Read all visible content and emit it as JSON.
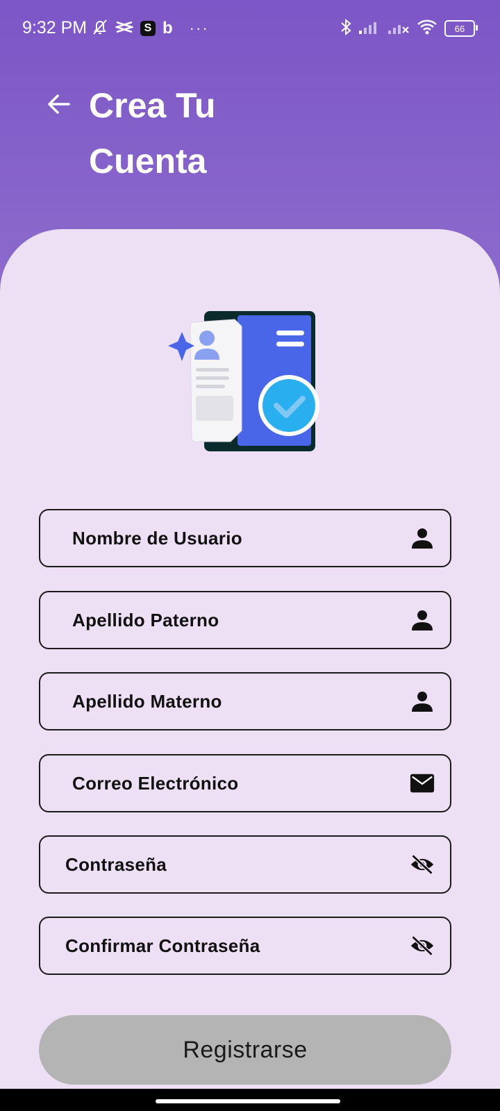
{
  "status_bar": {
    "time": "9:32 PM",
    "left_icons": [
      "bell-off-icon",
      "capcut-icon",
      "s-app-icon",
      "bing-icon",
      "more-dots-icon"
    ],
    "s_app_letter": "S",
    "bing_letter": "b",
    "dots": "···",
    "right_icons": [
      "bluetooth-icon",
      "signal-icon",
      "signal-off-icon",
      "wifi-icon",
      "battery-icon"
    ],
    "battery_level": "66"
  },
  "header": {
    "title": "Crea Tu Cuenta",
    "back_icon": "arrow-left-icon"
  },
  "colors": {
    "header_bg": "#7c56c6",
    "card_bg": "#ede0f4",
    "button_bg": "#b4b4b4",
    "illustration_blue": "#4a66e8",
    "check_blue": "#29aef0"
  },
  "form": {
    "fields": [
      {
        "label": "Nombre de Usuario",
        "icon": "person-icon"
      },
      {
        "label": "Apellido Paterno",
        "icon": "person-icon"
      },
      {
        "label": "Apellido Materno",
        "icon": "person-icon"
      },
      {
        "label": "Correo Electrónico",
        "icon": "mail-icon"
      },
      {
        "label": "Contraseña",
        "icon": "eye-off-icon"
      },
      {
        "label": "Confirmar Contraseña",
        "icon": "eye-off-icon"
      }
    ],
    "submit_label": "Registrarse"
  }
}
